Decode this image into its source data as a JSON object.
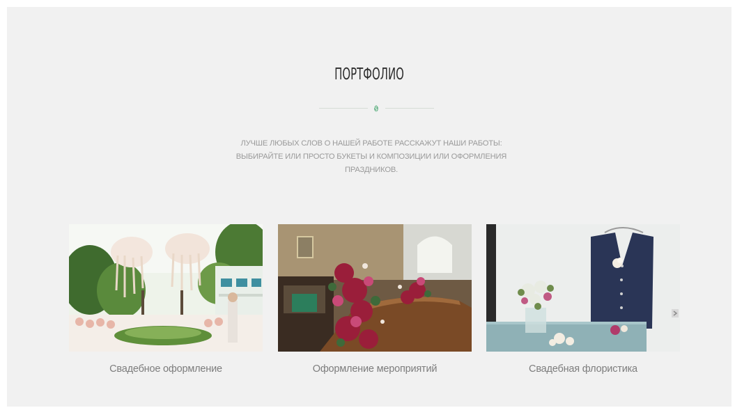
{
  "portfolio": {
    "title": "ПОРТФОЛИО",
    "intro_lines": [
      "ЛУЧШЕ ЛЮБЫХ СЛОВ О НАШЕЙ РАБОТЕ РАССКАЖУТ НАШИ РАБОТЫ:",
      "ВЫБИРАЙТЕ ИЛИ ПРОСТО БУКЕТЫ И КОМПОЗИЦИИ ИЛИ ОФОРМЛЕНИЯ",
      "ПРАЗДНИКОВ."
    ],
    "divider_icon": "leaf-icon",
    "items": [
      {
        "caption": "Свадебное оформление"
      },
      {
        "caption": "Оформление мероприятий"
      },
      {
        "caption": "Свадебная флористика"
      }
    ],
    "next_icon": "chevron-right-icon"
  },
  "colors": {
    "background": "#f1f1f1",
    "accent": "#6bb38a",
    "title": "#2d2d2d",
    "muted_text": "#9a9a9a"
  }
}
